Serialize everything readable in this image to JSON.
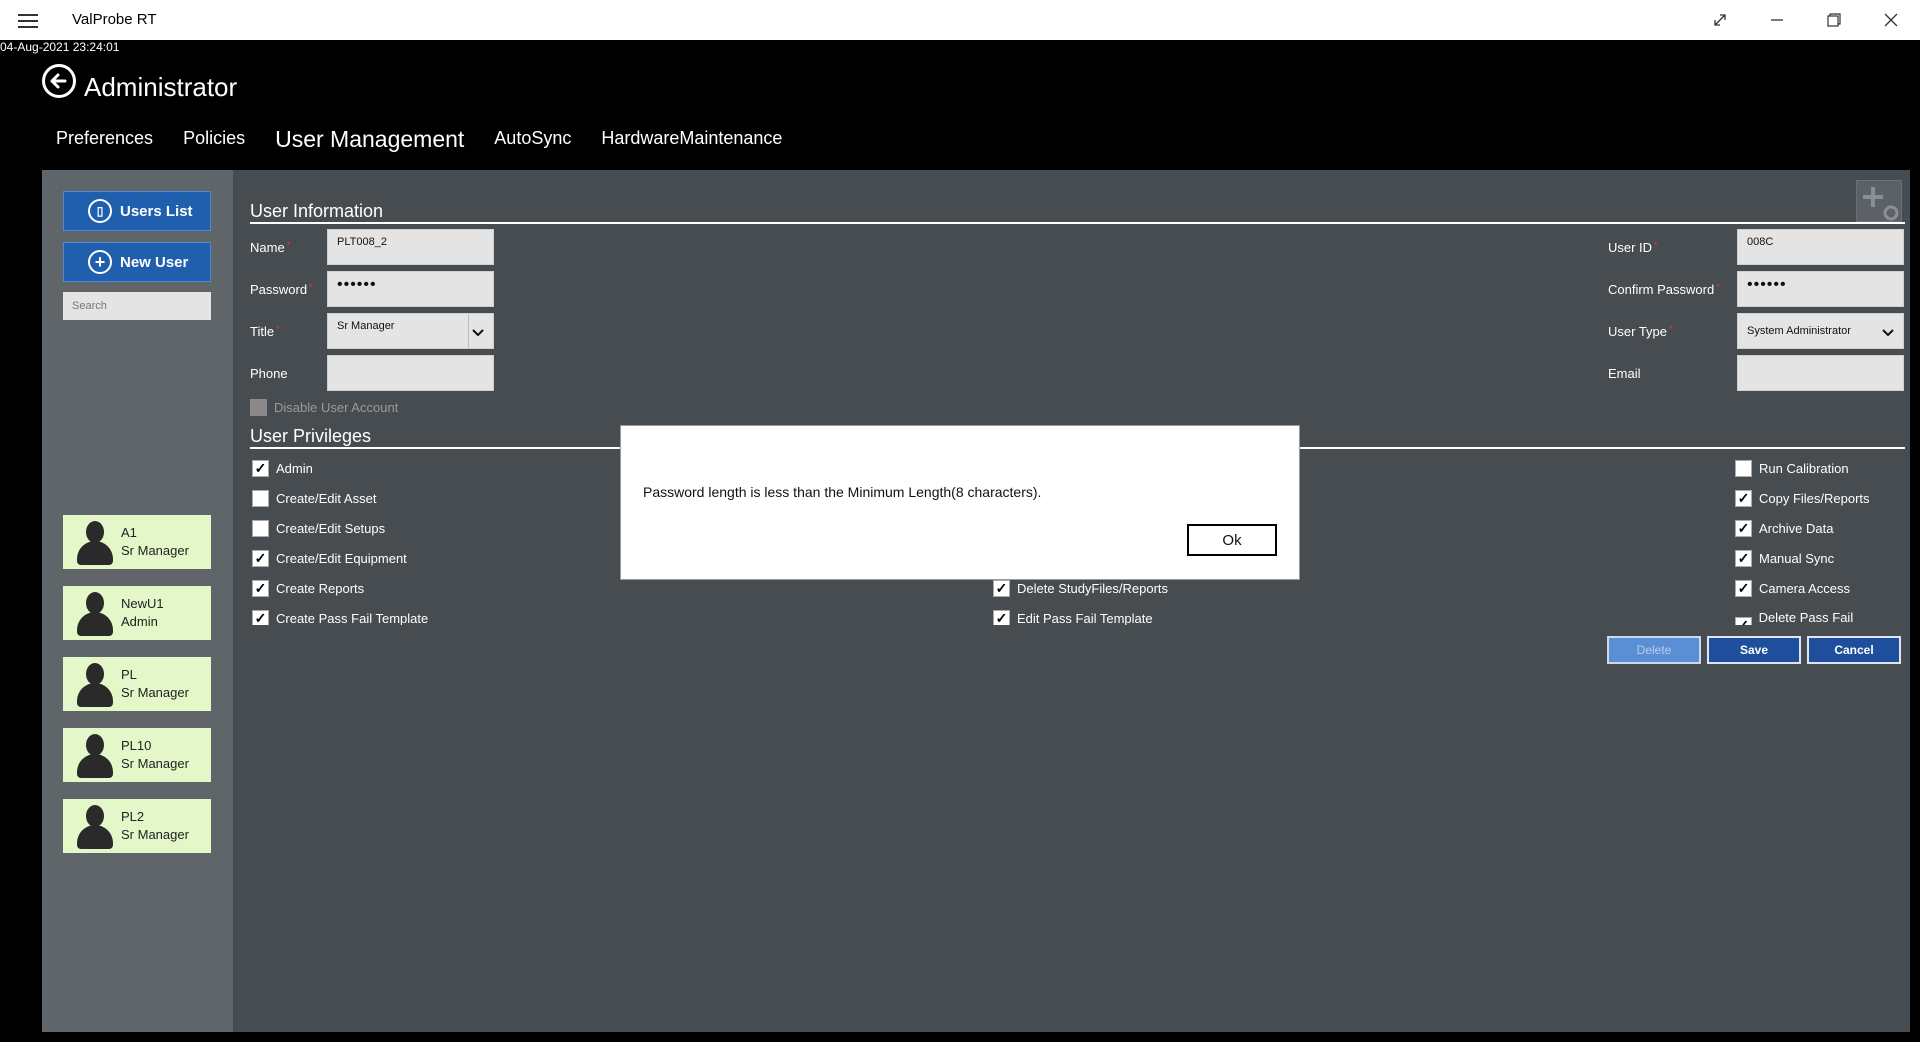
{
  "window": {
    "title": "ValProbe RT",
    "datetime": "04-Aug-2021 23:24:01"
  },
  "header": {
    "title": "Administrator"
  },
  "nav": {
    "tabs": [
      "Preferences",
      "Policies",
      "User Management",
      "AutoSync",
      "HardwareMaintenance"
    ],
    "active": "User Management"
  },
  "sidebar": {
    "users_list_label": "Users List",
    "new_user_label": "New User",
    "search_placeholder": "Search",
    "users": [
      {
        "name": "A1",
        "role": "Sr Manager"
      },
      {
        "name": "NewU1",
        "role": "Admin"
      },
      {
        "name": "PL",
        "role": "Sr Manager"
      },
      {
        "name": "PL10",
        "role": "Sr Manager"
      },
      {
        "name": "PL2",
        "role": "Sr Manager"
      }
    ]
  },
  "user_info": {
    "section_title": "User Information",
    "name_label": "Name",
    "name_value": "PLT008_2",
    "password_label": "Password",
    "password_value": "••••••",
    "title_label": "Title",
    "title_value": "Sr Manager",
    "phone_label": "Phone",
    "phone_value": "",
    "user_id_label": "User ID",
    "user_id_value": "008C",
    "confirm_password_label": "Confirm Password",
    "confirm_password_value": "••••••",
    "user_type_label": "User Type",
    "user_type_value": "System Administrator",
    "email_label": "Email",
    "email_value": "",
    "disable_account_label": "Disable User Account"
  },
  "privileges": {
    "section_title": "User Privileges",
    "col1": [
      {
        "label": "Admin",
        "checked": true
      },
      {
        "label": "Create/Edit Asset",
        "checked": false
      },
      {
        "label": "Create/Edit Setups",
        "checked": false
      },
      {
        "label": "Create/Edit Equipment",
        "checked": true
      },
      {
        "label": "Create Reports",
        "checked": true
      },
      {
        "label": "Create Pass Fail Template",
        "checked": true
      }
    ],
    "col2": [
      {
        "label": "Delete StudyFiles/Reports",
        "checked": true
      },
      {
        "label": "Edit Pass Fail Template",
        "checked": true
      }
    ],
    "col3": [
      {
        "label": "Run Calibration",
        "checked": false
      },
      {
        "label": "Copy Files/Reports",
        "checked": true
      },
      {
        "label": "Archive Data",
        "checked": true
      },
      {
        "label": "Manual Sync",
        "checked": true
      },
      {
        "label": "Camera Access",
        "checked": true
      },
      {
        "label": "Delete Pass Fail Template",
        "checked": true
      }
    ]
  },
  "actions": {
    "delete_label": "Delete",
    "save_label": "Save",
    "cancel_label": "Cancel"
  },
  "dialog": {
    "message": "Password length is less than the Minimum Length(8 characters).",
    "ok_label": "Ok"
  }
}
